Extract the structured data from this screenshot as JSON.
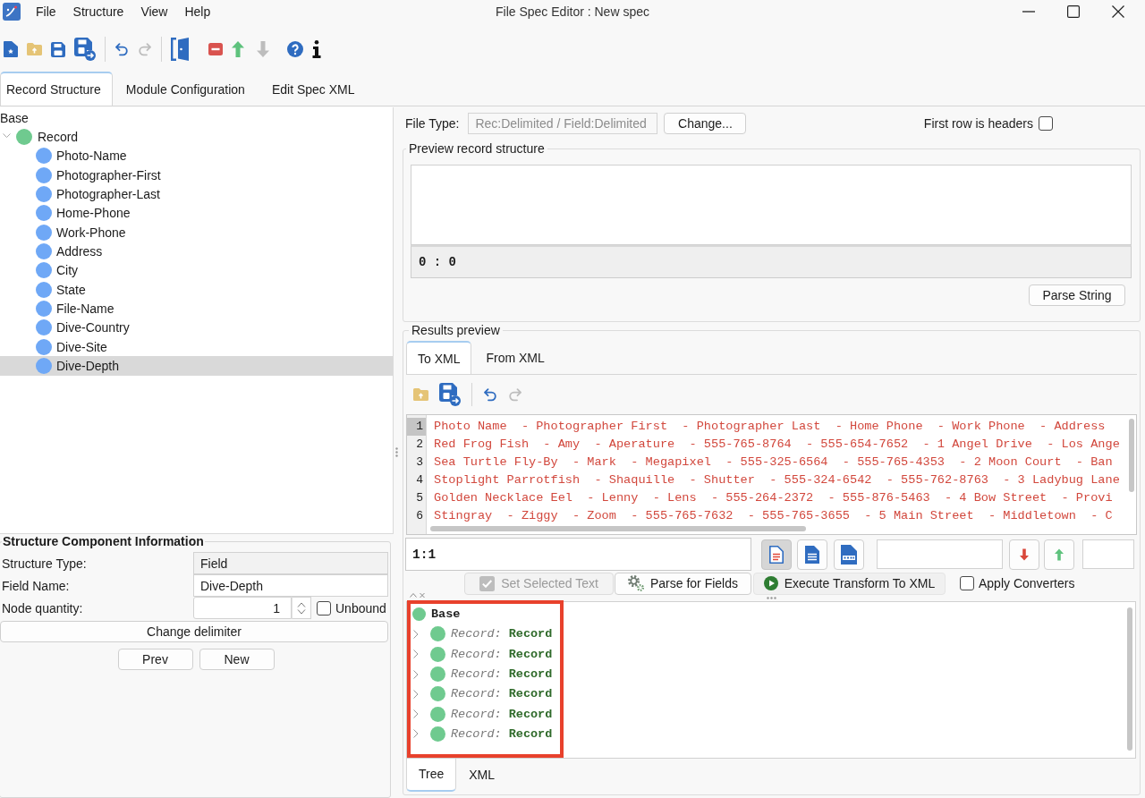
{
  "window": {
    "title": "File Spec Editor : New spec"
  },
  "menu": [
    "File",
    "Structure",
    "View",
    "Help"
  ],
  "toolbar": [
    [
      {
        "kind": "new-file",
        "disabled": false
      },
      {
        "kind": "open-folder",
        "disabled": false
      },
      {
        "kind": "save",
        "disabled": false
      },
      {
        "kind": "save-as",
        "disabled": false
      }
    ],
    [
      {
        "kind": "undo",
        "disabled": false
      },
      {
        "kind": "redo",
        "disabled": true
      }
    ],
    [
      {
        "kind": "exit",
        "disabled": false
      },
      {
        "kind": "remove",
        "disabled": false
      },
      {
        "kind": "move-up",
        "disabled": false
      },
      {
        "kind": "move-down",
        "disabled": true
      },
      {
        "kind": "help",
        "disabled": false
      },
      {
        "kind": "info",
        "disabled": false
      }
    ]
  ],
  "tabs": [
    {
      "label": "Record Structure",
      "selected": true
    },
    {
      "label": "Module Configuration",
      "selected": false
    },
    {
      "label": "Edit Spec XML",
      "selected": false
    }
  ],
  "structure_tree": {
    "label": "Base",
    "children": [
      {
        "label": "Record",
        "color": "#6fca8f",
        "expanded": true,
        "selected": false,
        "children": [
          {
            "label": "Photo-Name",
            "color": "#6fa8f6",
            "selected": false
          },
          {
            "label": "Photographer-First",
            "color": "#6fa8f6",
            "selected": false
          },
          {
            "label": "Photographer-Last",
            "color": "#6fa8f6",
            "selected": false
          },
          {
            "label": "Home-Phone",
            "color": "#6fa8f6",
            "selected": false
          },
          {
            "label": "Work-Phone",
            "color": "#6fa8f6",
            "selected": false
          },
          {
            "label": "Address",
            "color": "#6fa8f6",
            "selected": false
          },
          {
            "label": "City",
            "color": "#6fa8f6",
            "selected": false
          },
          {
            "label": "State",
            "color": "#6fa8f6",
            "selected": false
          },
          {
            "label": "File-Name",
            "color": "#6fa8f6",
            "selected": false
          },
          {
            "label": "Dive-Country",
            "color": "#6fa8f6",
            "selected": false
          },
          {
            "label": "Dive-Site",
            "color": "#6fa8f6",
            "selected": false
          },
          {
            "label": "Dive-Depth",
            "color": "#6fa8f6",
            "selected": true
          }
        ]
      }
    ]
  },
  "component_info": {
    "title": "Structure Component Information",
    "structure_type": {
      "label": "Structure Type:",
      "value": "Field"
    },
    "field_name": {
      "label": "Field Name:",
      "value": "Dive-Depth"
    },
    "node_quantity": {
      "label": "Node quantity:",
      "value": "1"
    },
    "unbound": {
      "label": "Unbound",
      "checked": false
    },
    "change_delimiter": "Change delimiter",
    "nav_buttons": [
      "Prev",
      "New"
    ]
  },
  "file_type": {
    "label": "File Type:",
    "value": "Rec:Delimited / Field:Delimited",
    "disabled": true,
    "button": "Change..."
  },
  "first_row_headers": {
    "label": "First row is headers",
    "checked": false
  },
  "preview": {
    "title": "Preview record structure",
    "position": "0 : 0",
    "button": "Parse String"
  },
  "results": {
    "title": "Results preview",
    "tabs": [
      {
        "label": "To XML",
        "selected": true
      },
      {
        "label": "From XML",
        "selected": false
      }
    ],
    "toolbar": [
      [
        {
          "kind": "open-folder",
          "disabled": false
        },
        {
          "kind": "save-as",
          "disabled": false
        }
      ],
      [
        {
          "kind": "undo",
          "disabled": false
        },
        {
          "kind": "redo",
          "disabled": true
        }
      ]
    ],
    "editor": {
      "lines": [
        {
          "number": "1",
          "current": true,
          "text": "Photo Name  - Photographer First  - Photographer Last  - Home Phone  - Work Phone  - Address"
        },
        {
          "number": "2",
          "current": false,
          "text": "Red Frog Fish  - Amy  - Aperature  - 555-765-8764  - 555-654-7652  - 1 Angel Drive  - Los Ange"
        },
        {
          "number": "3",
          "current": false,
          "text": "Sea Turtle Fly-By  - Mark  - Megapixel  - 555-325-6564  - 555-765-4353  - 2 Moon Court  - Ban"
        },
        {
          "number": "4",
          "current": false,
          "text": "Stoplight Parrotfish  - Shaquille  - Shutter  - 555-324-6542  - 555-762-8763  - 3 Ladybug Lane"
        },
        {
          "number": "5",
          "current": false,
          "text": "Golden Necklace Eel  - Lenny  - Lens  - 555-264-2372  - 555-876-5463  - 4 Bow Street  - Provi"
        },
        {
          "number": "6",
          "current": false,
          "text": "Stingray  - Ziggy  - Zoom  - 555-765-7632  - 555-765-3655  - 5 Main Street  - Middletown  - C"
        }
      ]
    },
    "cursor": "1:1",
    "view_buttons": [
      {
        "kind": "source",
        "selected": true
      },
      {
        "kind": "text",
        "selected": false
      },
      {
        "kind": "html",
        "selected": false
      }
    ]
  },
  "actions": [
    {
      "kind": "set",
      "label": "Set Selected Text",
      "disabled": true
    },
    {
      "kind": "parse",
      "label": "Parse for Fields",
      "disabled": false
    },
    {
      "kind": "execute",
      "label": "Execute Transform To XML",
      "disabled": false
    }
  ],
  "apply_converters": {
    "label": "Apply Converters",
    "checked": false
  },
  "xml_tree": {
    "highlighted": true,
    "root": {
      "label": "Base",
      "color": "#6fca8f"
    },
    "items": [
      {
        "type": "Record:",
        "name": "Record",
        "color": "#6fca8f",
        "expanded": false
      },
      {
        "type": "Record:",
        "name": "Record",
        "color": "#6fca8f",
        "expanded": false
      },
      {
        "type": "Record:",
        "name": "Record",
        "color": "#6fca8f",
        "expanded": false
      },
      {
        "type": "Record:",
        "name": "Record",
        "color": "#6fca8f",
        "expanded": false
      },
      {
        "type": "Record:",
        "name": "Record",
        "color": "#6fca8f",
        "expanded": false
      },
      {
        "type": "Record:",
        "name": "Record",
        "color": "#6fca8f",
        "expanded": false
      }
    ]
  },
  "bottom_tabs": [
    {
      "label": "Tree",
      "selected": true
    },
    {
      "label": "XML",
      "selected": false
    }
  ]
}
